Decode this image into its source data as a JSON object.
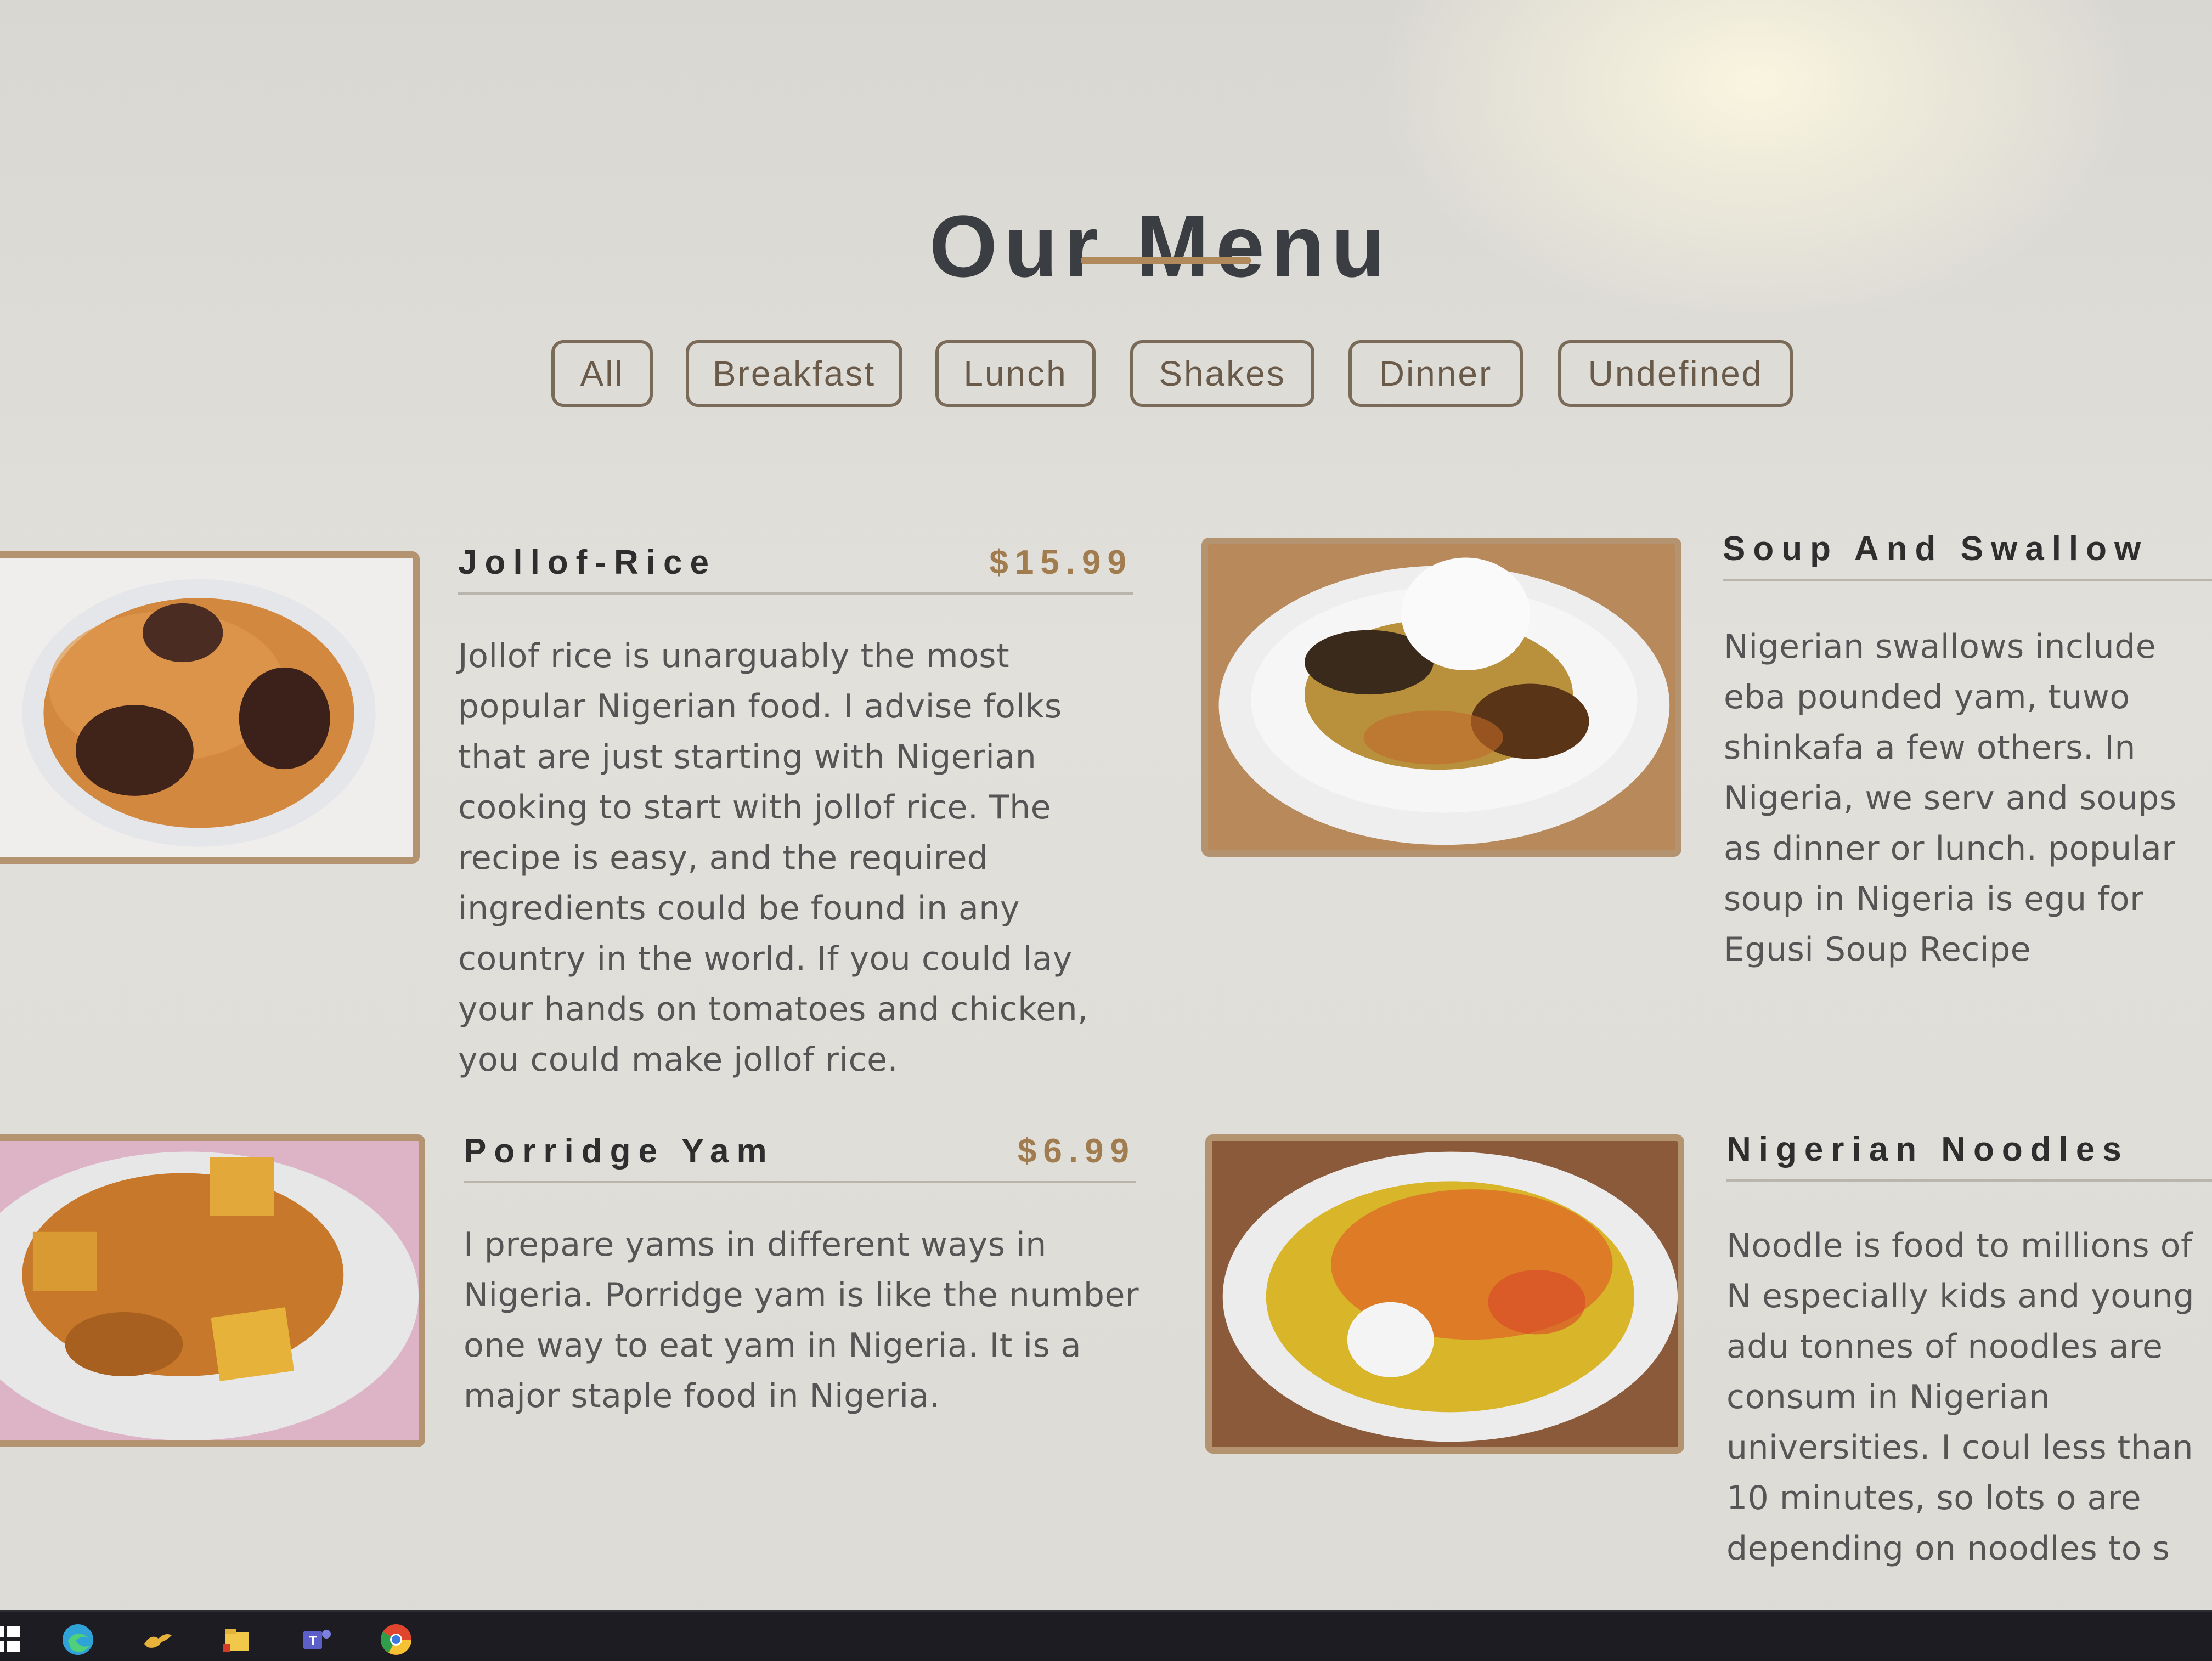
{
  "page": {
    "title": "Our Menu"
  },
  "filters": [
    "All",
    "Breakfast",
    "Lunch",
    "Shakes",
    "Dinner",
    "Undefined"
  ],
  "menu_items": [
    {
      "name": "Jollof-Rice",
      "price": "$15.99",
      "description": "Jollof rice is unarguably the most popular Nigerian food. I advise folks that are just starting with Nigerian cooking to start with jollof rice. The recipe is easy, and the required ingredients could be found in any country in the world. If you could lay your hands on tomatoes and chicken, you could make jollof rice.",
      "image_icon": "jollof-rice-image"
    },
    {
      "name": "Soup And Swallow",
      "price": "",
      "description": "Nigerian swallows include eba pounded yam, tuwo shinkafa a few others. In Nigeria, we serv and soups as dinner or lunch. popular soup in Nigeria is egu for Egusi Soup Recipe",
      "image_icon": "soup-and-swallow-image"
    },
    {
      "name": "Porridge Yam",
      "price": "$6.99",
      "description": "I prepare yams in different ways in Nigeria. Porridge yam is like the number one way to eat yam in Nigeria. It is a major staple food in Nigeria.",
      "image_icon": "porridge-yam-image"
    },
    {
      "name": "Nigerian Noodles",
      "price": "",
      "description": "Noodle is food to millions of N especially kids and young adu tonnes of noodles are consum in Nigerian universities. I coul less than 10 minutes, so lots o are depending on noodles to s",
      "image_icon": "nigerian-noodles-image"
    }
  ],
  "taskbar": {
    "icons": [
      "start-icon",
      "edge-icon",
      "lizard-app-icon",
      "file-explorer-icon",
      "teams-icon",
      "chrome-icon"
    ]
  },
  "colors": {
    "accent": "#b08a5a",
    "price": "#a07c4e",
    "frame": "#b39370",
    "heading": "#3a3d42"
  }
}
